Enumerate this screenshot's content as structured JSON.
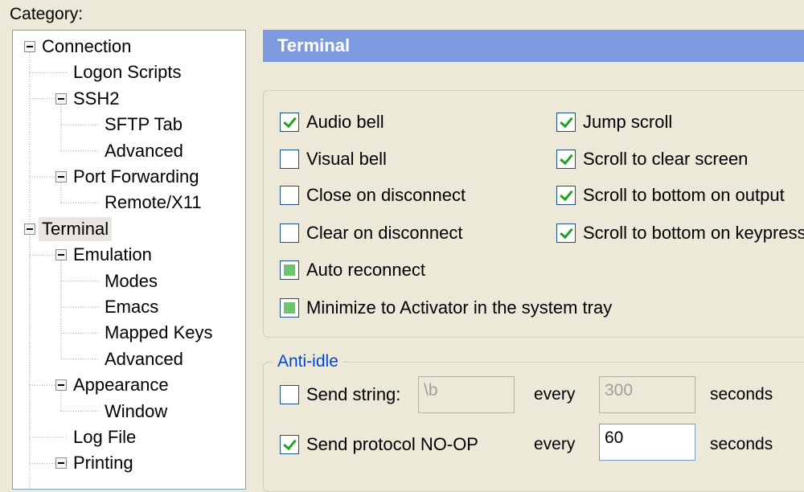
{
  "category_label": "Category:",
  "tree": [
    {
      "label": "Connection"
    },
    {
      "label": "Logon Scripts"
    },
    {
      "label": "SSH2"
    },
    {
      "label": "SFTP Tab"
    },
    {
      "label": "Advanced"
    },
    {
      "label": "Port Forwarding"
    },
    {
      "label": "Remote/X11"
    },
    {
      "label": "Terminal",
      "selected": true
    },
    {
      "label": "Emulation"
    },
    {
      "label": "Modes"
    },
    {
      "label": "Emacs"
    },
    {
      "label": "Mapped Keys"
    },
    {
      "label": "Advanced"
    },
    {
      "label": "Appearance"
    },
    {
      "label": "Window"
    },
    {
      "label": "Log File"
    },
    {
      "label": "Printing"
    }
  ],
  "panel": {
    "title": "Terminal",
    "options": [
      {
        "label": "Audio bell",
        "state": "checked"
      },
      {
        "label": "Visual bell",
        "state": "unchecked"
      },
      {
        "label": "Close on disconnect",
        "state": "unchecked"
      },
      {
        "label": "Clear on disconnect",
        "state": "unchecked"
      },
      {
        "label": "Auto reconnect",
        "state": "indeterminate"
      },
      {
        "label": "Minimize to Activator in the system tray",
        "state": "indeterminate"
      },
      {
        "label": "Jump scroll",
        "state": "checked"
      },
      {
        "label": "Scroll to clear screen",
        "state": "checked"
      },
      {
        "label": "Scroll to bottom on output",
        "state": "checked"
      },
      {
        "label": "Scroll to bottom on keypress",
        "state": "checked"
      }
    ],
    "anti_idle": {
      "legend": "Anti-idle",
      "send_string": {
        "label": "Send string:",
        "state": "unchecked",
        "value": "\\b",
        "every": "every",
        "seconds_value": "300",
        "seconds_label": "seconds"
      },
      "send_noop": {
        "label": "Send protocol NO-OP",
        "state": "checked",
        "every": "every",
        "seconds_value": "60",
        "seconds_label": "seconds"
      }
    }
  },
  "colors": {
    "title_bar": "#7f9be0",
    "legend_text": "#0046d5",
    "checkmark": "#21a121",
    "indeterminate_fill": "#73c273"
  }
}
